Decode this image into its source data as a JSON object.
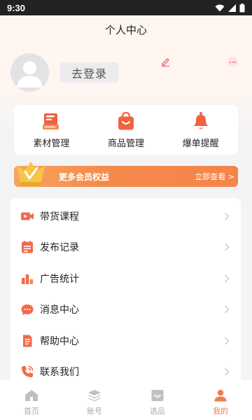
{
  "status_bar": {
    "time": "9:30",
    "icons": [
      "wifi-icon",
      "cellular-signal-icon",
      "battery-icon"
    ]
  },
  "header": {
    "title": "个人中心"
  },
  "profile": {
    "login_label": "去登录",
    "edit_icon": "pencil-icon",
    "more_icon": "more-dots-icon"
  },
  "quick_actions": [
    {
      "label": "素材管理",
      "icon": "material-book-icon"
    },
    {
      "label": "商品管理",
      "icon": "shopping-bag-icon"
    },
    {
      "label": "爆单提醒",
      "icon": "bell-icon"
    }
  ],
  "vip_banner": {
    "text": "更多会员权益",
    "link": "立即查看 >",
    "icon": "crown-badge-icon"
  },
  "menu": [
    {
      "label": "带货课程",
      "icon": "video-course-icon"
    },
    {
      "label": "发布记录",
      "icon": "calendar-record-icon"
    },
    {
      "label": "广告统计",
      "icon": "bar-chart-icon"
    },
    {
      "label": "消息中心",
      "icon": "chat-bubble-icon"
    },
    {
      "label": "帮助中心",
      "icon": "document-icon"
    },
    {
      "label": "联系我们",
      "icon": "phone-icon"
    }
  ],
  "tabs": [
    {
      "label": "首页",
      "icon": "home-icon",
      "active": false
    },
    {
      "label": "账号",
      "icon": "layers-icon",
      "active": false
    },
    {
      "label": "选品",
      "icon": "tray-icon",
      "active": false
    },
    {
      "label": "我的",
      "icon": "user-icon",
      "active": true
    }
  ],
  "colors": {
    "accent": "#f47c45",
    "accent_light": "#f7a55f",
    "background": "#f4f4f6",
    "tab_inactive": "#aaaaaa"
  }
}
